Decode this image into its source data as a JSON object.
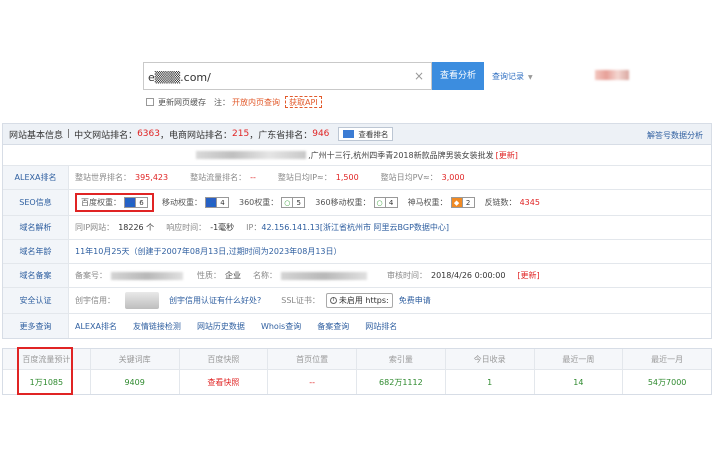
{
  "search": {
    "value": "e▒▒▒.com/",
    "clear_icon": "×",
    "button": "查看分析",
    "history": "查询记录",
    "update_cache": "更新网页缓存",
    "note_prefix": "注：",
    "open_inner": "开放内页查询",
    "api": "获取API"
  },
  "header": {
    "title": "网站基本信息",
    "cn_rank_label": "中文网站排名：",
    "cn_rank": "6363",
    "ec_rank_label": "电商网站排名：",
    "ec_rank": "215",
    "gd_rank_label": "广东省排名：",
    "gd_rank": "946",
    "rank_btn": "查看排名",
    "right": "解答号数据分析"
  },
  "title_row": {
    "text": ",广州十三行,杭州四季青2018新款品牌男装女装批发",
    "update": "[更新]"
  },
  "alexa": {
    "label": "ALEXA排名",
    "world_label": "整站世界排名：",
    "world": "395,423",
    "flow_label": "整站流量排名：",
    "flow": "--",
    "ip_label": "整站日均IP≈：",
    "ip": "1,500",
    "pv_label": "整站日均PV≈：",
    "pv": "3,000"
  },
  "seo": {
    "label": "SEO信息",
    "baidu_label": "百度权重：",
    "baidu": "6",
    "mobile_label": "移动权重：",
    "mobile": "4",
    "s360_label": "360权重：",
    "s360": "5",
    "m360_label": "360移动权重：",
    "m360": "4",
    "shenma_label": "神马权重：",
    "shenma": "2",
    "backlink_label": "反链数：",
    "backlink": "4345"
  },
  "dns": {
    "label": "域名解析",
    "same_ip_label": "同IP网站：",
    "same_ip": "18226 个",
    "speed_label": "响应时间：",
    "speed": "-1毫秒",
    "ip_label": "IP：",
    "ip": "42.156.141.13[浙江省杭州市 阿里云BGP数据中心]"
  },
  "age": {
    "label": "域名年龄",
    "text": "11年10月25天（创建于2007年08月13日,过期时间为2023年08月13日）"
  },
  "icp": {
    "label": "域名备案",
    "no_label": "备案号：",
    "nature_label": "性质：",
    "nature": "企业",
    "name_label": "名称：",
    "time_label": "审核时间：",
    "time": "2018/4/26 0:00:00",
    "update": "[更新]"
  },
  "security": {
    "label": "安全认证",
    "trust_label": "创宇信用：",
    "question": "创宇信用认证有什么好处?",
    "ssl_label": "SSL证书：",
    "https": "未启用 https:",
    "free": "免费申请"
  },
  "more": {
    "label": "更多查询",
    "links": [
      "ALEXA排名",
      "友情链接检测",
      "网站历史数据",
      "Whois查询",
      "备案查询",
      "网站排名"
    ]
  },
  "stats": {
    "headers": [
      "百度流量预计",
      "关键词库",
      "百度快照",
      "首页位置",
      "索引量",
      "今日收录",
      "最近一周",
      "最近一月"
    ],
    "values": [
      "1万1085",
      "9409",
      "查看快照",
      "--",
      "682万1112",
      "1",
      "14",
      "54万7000"
    ]
  },
  "colors": {
    "accent": "#3c8ddf",
    "red": "#e02424",
    "link": "#2f5fa0",
    "green": "#2f8a2f"
  }
}
